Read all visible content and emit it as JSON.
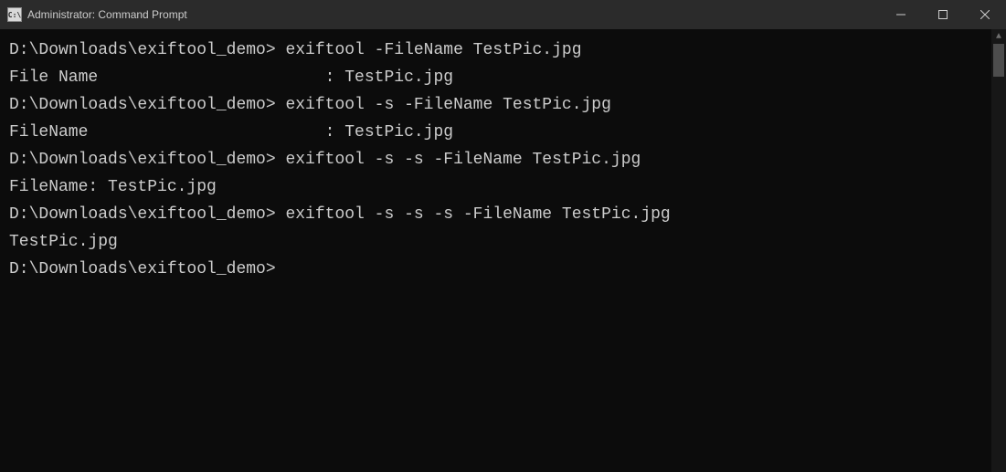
{
  "titlebar": {
    "icon_text": "C:\\",
    "title": "Administrator: Command Prompt"
  },
  "terminal": {
    "prompt": "D:\\Downloads\\exiftool_demo>",
    "blocks": [
      {
        "command": "exiftool -FileName TestPic.jpg",
        "output": "File Name                       : TestPic.jpg"
      },
      {
        "command": "exiftool -s -FileName TestPic.jpg",
        "output": "FileName                        : TestPic.jpg"
      },
      {
        "command": "exiftool -s -s -FileName TestPic.jpg",
        "output": "FileName: TestPic.jpg"
      },
      {
        "command": "exiftool -s -s -s -FileName TestPic.jpg",
        "output": "TestPic.jpg"
      }
    ]
  }
}
